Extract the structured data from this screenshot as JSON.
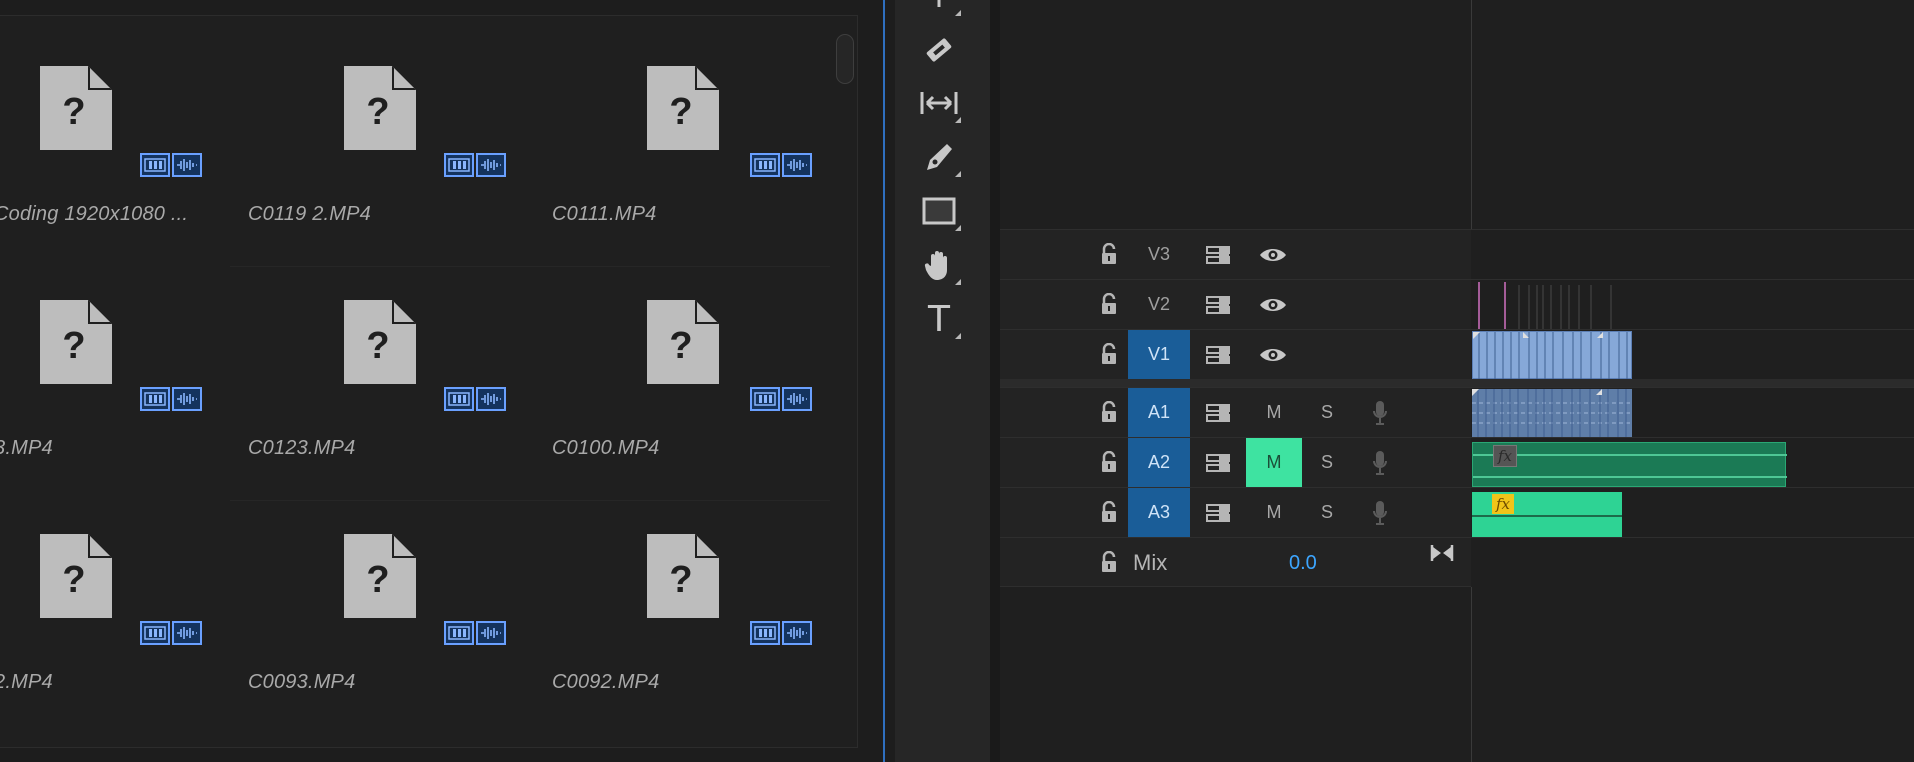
{
  "project": {
    "clips": [
      {
        "name": "Coding 1920x1080 ...",
        "icon": "unknown-file-icon"
      },
      {
        "name": "C0119 2.MP4",
        "icon": "unknown-file-icon"
      },
      {
        "name": "C0111.MP4",
        "icon": "unknown-file-icon"
      },
      {
        "name": "3.MP4",
        "icon": "unknown-file-icon"
      },
      {
        "name": "C0123.MP4",
        "icon": "unknown-file-icon"
      },
      {
        "name": "C0100.MP4",
        "icon": "unknown-file-icon"
      },
      {
        "name": "2.MP4",
        "icon": "unknown-file-icon"
      },
      {
        "name": "C0093.MP4",
        "icon": "unknown-file-icon"
      },
      {
        "name": "C0092.MP4",
        "icon": "unknown-file-icon"
      }
    ],
    "file_icon_glyph": "?"
  },
  "tools": [
    {
      "name": "razor-tool",
      "icon": "razor-icon"
    },
    {
      "name": "slip-tool",
      "icon": "slip-icon"
    },
    {
      "name": "pen-tool",
      "icon": "pen-icon"
    },
    {
      "name": "rectangle-tool",
      "icon": "rectangle-icon"
    },
    {
      "name": "hand-tool",
      "icon": "hand-icon"
    },
    {
      "name": "type-tool",
      "icon": "type-icon",
      "glyph": "T"
    }
  ],
  "timeline": {
    "video_tracks": [
      {
        "label": "V3",
        "active": false
      },
      {
        "label": "V2",
        "active": false
      },
      {
        "label": "V1",
        "active": true
      }
    ],
    "audio_tracks": [
      {
        "label": "A1",
        "active": true,
        "mute": "M",
        "solo": "S",
        "mute_on": false
      },
      {
        "label": "A2",
        "active": true,
        "mute": "M",
        "solo": "S",
        "mute_on": true
      },
      {
        "label": "A3",
        "active": true,
        "mute": "M",
        "solo": "S",
        "mute_on": false
      }
    ],
    "mix": {
      "label": "Mix",
      "value": "0.0"
    },
    "fx_label": "fx"
  },
  "colors": {
    "accent_blue": "#1a5d98",
    "mute_on": "#3ee3a1",
    "video_clip": "#86a8d8",
    "audio_clip": "#2ed394",
    "badge_border": "#6aa0ff"
  }
}
